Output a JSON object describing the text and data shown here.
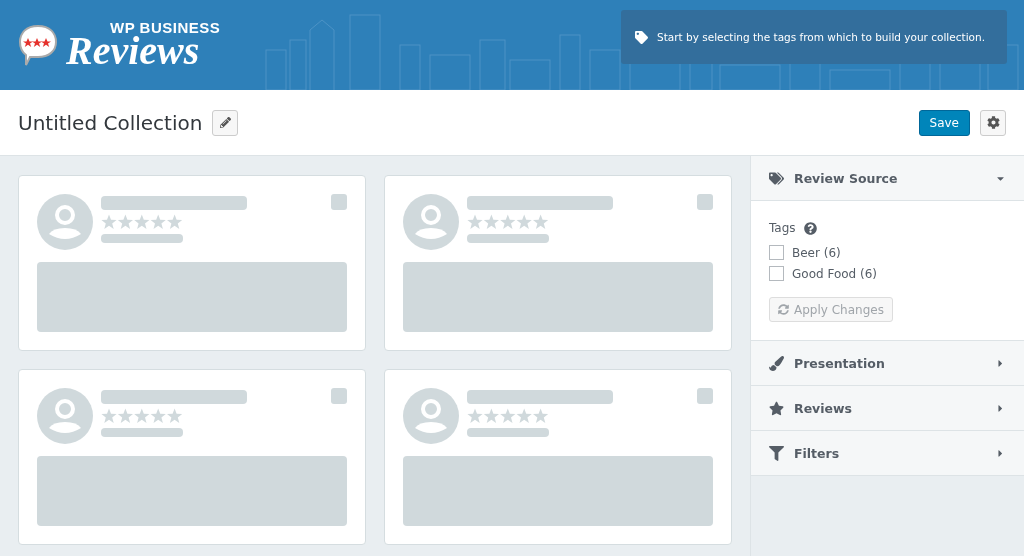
{
  "header": {
    "logo": {
      "top": "WP BUSINESS",
      "script": "Reviews"
    },
    "notice": "Start by selecting the tags from which to build your collection."
  },
  "toolbar": {
    "title": "Untitled Collection",
    "save": "Save"
  },
  "cards": [
    {
      "stars": 0
    },
    {
      "stars": 0
    },
    {
      "stars": 0
    },
    {
      "stars": 0
    }
  ],
  "sidebar": {
    "sections": [
      {
        "label": "Review Source",
        "expanded": true
      },
      {
        "label": "Presentation",
        "expanded": false
      },
      {
        "label": "Reviews",
        "expanded": false
      },
      {
        "label": "Filters",
        "expanded": false
      }
    ],
    "tags": {
      "label": "Tags",
      "items": [
        {
          "label": "Beer (6)",
          "checked": false
        },
        {
          "label": "Good Food (6)",
          "checked": false
        }
      ],
      "apply": {
        "label": "Apply Changes",
        "disabled": true
      }
    }
  }
}
